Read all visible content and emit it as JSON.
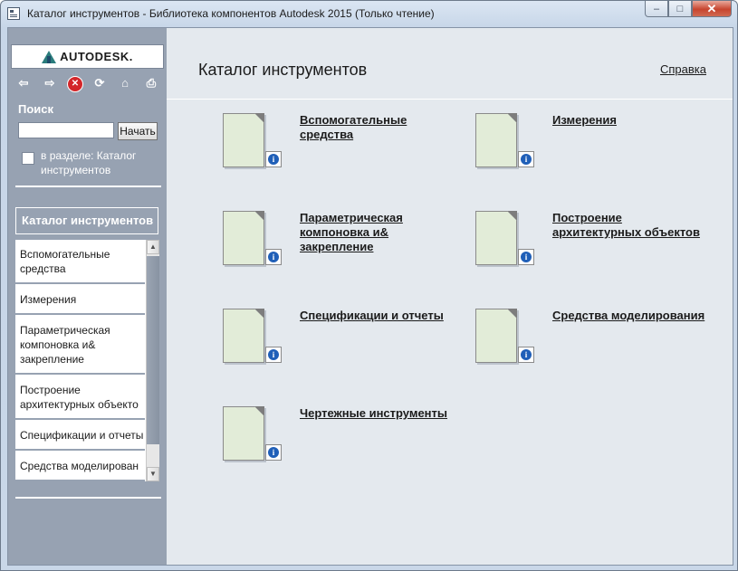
{
  "window": {
    "title": "Каталог инструментов - Библиотека компонентов Autodesk 2015 (Только чтение)",
    "buttons": {
      "minimize": "–",
      "maximize": "□",
      "close": "✕"
    }
  },
  "sidebar": {
    "logo_text": "AUTODESK.",
    "toolbar_icons": [
      "back-arrow-icon",
      "forward-arrow-icon",
      "stop-icon",
      "refresh-icon",
      "home-icon",
      "print-icon"
    ],
    "search_label": "Поиск",
    "search_placeholder": "",
    "search_button": "Начать",
    "in_section_label": "в разделе: Каталог инструментов",
    "in_section_checked": false,
    "category_header": "Каталог инструментов",
    "list_items": [
      "Вспомогательные средства",
      "Измерения",
      "Параметрическая компоновка и& закрепление",
      "Построение архитектурных объекто",
      "Спецификации и отчеты",
      "Средства моделирован"
    ]
  },
  "main": {
    "title": "Каталог инструментов",
    "help_link": "Справка",
    "tiles": [
      "Вспомогательные средства",
      "Измерения",
      "Параметрическая компоновка и& закрепление",
      "Построение архитектурных объектов",
      "Спецификации и отчеты",
      "Средства моделирования",
      "Чертежные инструменты"
    ]
  },
  "colors": {
    "sidebar_bg": "#97a2b2",
    "main_bg": "#e4e9ee",
    "doc_fill": "#e2ecd8",
    "info_blue": "#1f5fb8",
    "stop_red": "#d3262a"
  }
}
